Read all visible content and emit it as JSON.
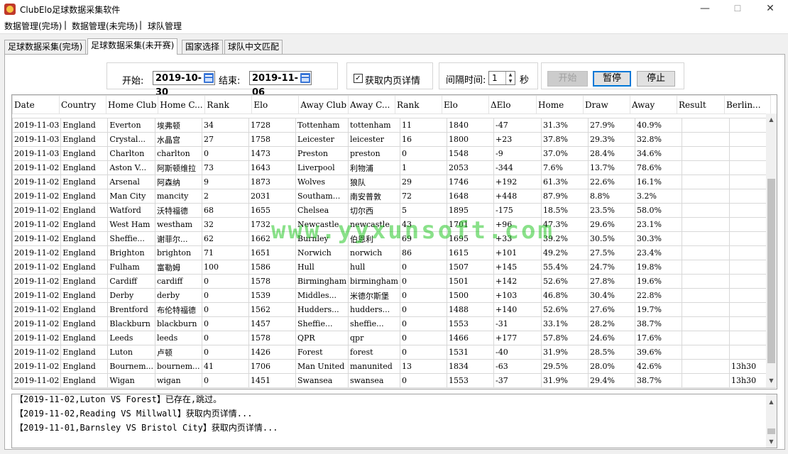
{
  "window": {
    "title": "ClubElo足球数据采集软件",
    "minimize": "—",
    "maximize": "☐",
    "close": "✕"
  },
  "menu": [
    "数据管理(完场)",
    "数据管理(未完场)",
    "球队管理"
  ],
  "tabs": [
    "足球数据采集(完场)",
    "足球数据采集(未开赛)",
    "国家选择",
    "球队中文匹配"
  ],
  "active_tab": 1,
  "controls": {
    "start_label": "开始:",
    "start_date": "2019-10-30",
    "end_label": "结束:",
    "end_date": "2019-11-06",
    "detail_check_label": "获取内页详情",
    "detail_checked": true,
    "interval_label": "间隔时间:",
    "interval_value": "1",
    "interval_unit": "秒",
    "btn_start": "开始",
    "btn_pause": "暂停",
    "btn_stop": "停止"
  },
  "table": {
    "columns": [
      "Date",
      "Country",
      "Home Club",
      "Home C...",
      "Rank",
      "Elo",
      "Away Club",
      "Away C...",
      "Rank",
      "Elo",
      "ΔElo",
      "Home",
      "Draw",
      "Away",
      "Result",
      "Berlin..."
    ],
    "rows": [
      [
        "2019-11-03",
        "England",
        "Everton",
        "埃弗顿",
        "34",
        "1728",
        "Tottenham",
        "tottenham",
        "11",
        "1840",
        "-47",
        "31.3%",
        "27.9%",
        "40.9%",
        "",
        ""
      ],
      [
        "2019-11-03",
        "England",
        "Crystal...",
        "水晶宫",
        "27",
        "1758",
        "Leicester",
        "leicester",
        "16",
        "1800",
        "+23",
        "37.8%",
        "29.3%",
        "32.8%",
        "",
        ""
      ],
      [
        "2019-11-03",
        "England",
        "Charlton",
        "charlton",
        "0",
        "1473",
        "Preston",
        "preston",
        "0",
        "1548",
        "-9",
        "37.0%",
        "28.4%",
        "34.6%",
        "",
        ""
      ],
      [
        "2019-11-02",
        "England",
        "Aston V...",
        "阿斯顿维拉",
        "73",
        "1643",
        "Liverpool",
        "利物浦",
        "1",
        "2053",
        "-344",
        "7.6%",
        "13.7%",
        "78.6%",
        "",
        ""
      ],
      [
        "2019-11-02",
        "England",
        "Arsenal",
        "阿森纳",
        "9",
        "1873",
        "Wolves",
        "狼队",
        "29",
        "1746",
        "+192",
        "61.3%",
        "22.6%",
        "16.1%",
        "",
        ""
      ],
      [
        "2019-11-02",
        "England",
        "Man City",
        "mancity",
        "2",
        "2031",
        "Southam...",
        "南安普敦",
        "72",
        "1648",
        "+448",
        "87.9%",
        "8.8%",
        "3.2%",
        "",
        ""
      ],
      [
        "2019-11-02",
        "England",
        "Watford",
        "沃特福德",
        "68",
        "1655",
        "Chelsea",
        "切尔西",
        "5",
        "1895",
        "-175",
        "18.5%",
        "23.5%",
        "58.0%",
        "",
        ""
      ],
      [
        "2019-11-02",
        "England",
        "West Ham",
        "westham",
        "32",
        "1732",
        "Newcastle",
        "newcastle",
        "43",
        "1701",
        "+96",
        "47.3%",
        "29.6%",
        "23.1%",
        "",
        ""
      ],
      [
        "2019-11-02",
        "England",
        "Sheffie...",
        "谢菲尔...",
        "62",
        "1662",
        "Burnley",
        "伯恩利",
        "69",
        "1695",
        "+33",
        "39.2%",
        "30.5%",
        "30.3%",
        "",
        ""
      ],
      [
        "2019-11-02",
        "England",
        "Brighton",
        "brighton",
        "71",
        "1651",
        "Norwich",
        "norwich",
        "86",
        "1615",
        "+101",
        "49.2%",
        "27.5%",
        "23.4%",
        "",
        ""
      ],
      [
        "2019-11-02",
        "England",
        "Fulham",
        "富勒姆",
        "100",
        "1586",
        "Hull",
        "hull",
        "0",
        "1507",
        "+145",
        "55.4%",
        "24.7%",
        "19.8%",
        "",
        ""
      ],
      [
        "2019-11-02",
        "England",
        "Cardiff",
        "cardiff",
        "0",
        "1578",
        "Birmingham",
        "birmingham",
        "0",
        "1501",
        "+142",
        "52.6%",
        "27.8%",
        "19.6%",
        "",
        ""
      ],
      [
        "2019-11-02",
        "England",
        "Derby",
        "derby",
        "0",
        "1539",
        "Middles...",
        "米德尔斯堡",
        "0",
        "1500",
        "+103",
        "46.8%",
        "30.4%",
        "22.8%",
        "",
        ""
      ],
      [
        "2019-11-02",
        "England",
        "Brentford",
        "布伦特福德",
        "0",
        "1562",
        "Hudders...",
        "hudders...",
        "0",
        "1488",
        "+140",
        "52.6%",
        "27.6%",
        "19.7%",
        "",
        ""
      ],
      [
        "2019-11-02",
        "England",
        "Blackburn",
        "blackburn",
        "0",
        "1457",
        "Sheffie...",
        "sheffie...",
        "0",
        "1553",
        "-31",
        "33.1%",
        "28.2%",
        "38.7%",
        "",
        ""
      ],
      [
        "2019-11-02",
        "England",
        "Leeds",
        "leeds",
        "0",
        "1578",
        "QPR",
        "qpr",
        "0",
        "1466",
        "+177",
        "57.8%",
        "24.6%",
        "17.6%",
        "",
        ""
      ],
      [
        "2019-11-02",
        "England",
        "Luton",
        "卢顿",
        "0",
        "1426",
        "Forest",
        "forest",
        "0",
        "1531",
        "-40",
        "31.9%",
        "28.5%",
        "39.6%",
        "",
        ""
      ],
      [
        "2019-11-02",
        "England",
        "Bournem...",
        "bournem...",
        "41",
        "1706",
        "Man United",
        "manunited",
        "13",
        "1834",
        "-63",
        "29.5%",
        "28.0%",
        "42.6%",
        "",
        "13h30"
      ],
      [
        "2019-11-02",
        "England",
        "Wigan",
        "wigan",
        "0",
        "1451",
        "Swansea",
        "swansea",
        "0",
        "1553",
        "-37",
        "31.9%",
        "29.4%",
        "38.7%",
        "",
        "13h30"
      ]
    ]
  },
  "watermark": "www.yyxunsoft.com",
  "log": [
    "【2019-11-02,Luton VS Forest】已存在,跳过。",
    "【2019-11-02,Reading VS Millwall】获取内页详情...",
    "【2019-11-01,Barnsley VS Bristol City】获取内页详情..."
  ]
}
